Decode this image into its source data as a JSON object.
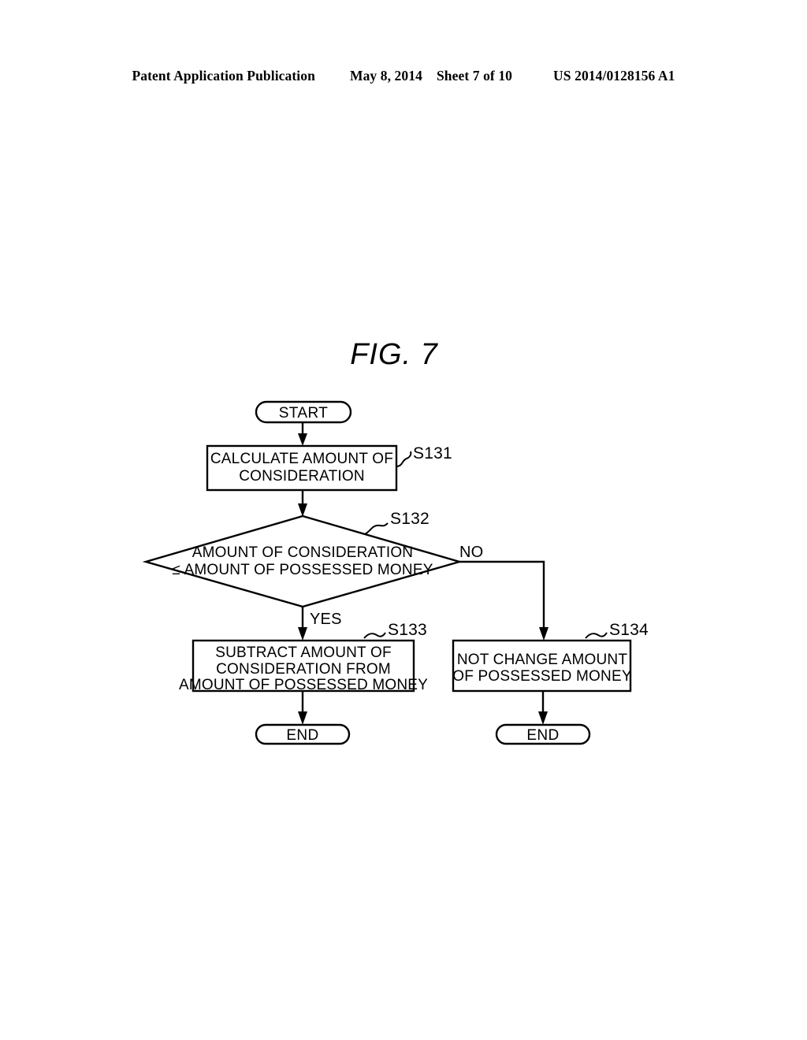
{
  "header": {
    "publication": "Patent Application Publication",
    "date": "May 8, 2014",
    "sheet": "Sheet 7 of 10",
    "document_number": "US 2014/0128156 A1"
  },
  "figure": {
    "title": "FIG. 7",
    "nodes": {
      "start": "START",
      "s131_text_line1": "CALCULATE AMOUNT OF",
      "s131_text_line2": "CONSIDERATION",
      "s132_text_line1": "AMOUNT OF CONSIDERATION",
      "s132_text_line2": "≤ AMOUNT OF POSSESSED MONEY",
      "s133_text_line1": "SUBTRACT AMOUNT OF",
      "s133_text_line2": "CONSIDERATION FROM",
      "s133_text_line3": "AMOUNT OF POSSESSED MONEY",
      "s134_text_line1": "NOT CHANGE AMOUNT",
      "s134_text_line2": "OF POSSESSED MONEY",
      "end_left": "END",
      "end_right": "END"
    },
    "step_labels": {
      "s131": "S131",
      "s132": "S132",
      "s133": "S133",
      "s134": "S134"
    },
    "branch_labels": {
      "yes": "YES",
      "no": "NO"
    },
    "colors": {
      "stroke": "#000000",
      "fill": "#ffffff",
      "background": "#ffffff"
    }
  }
}
